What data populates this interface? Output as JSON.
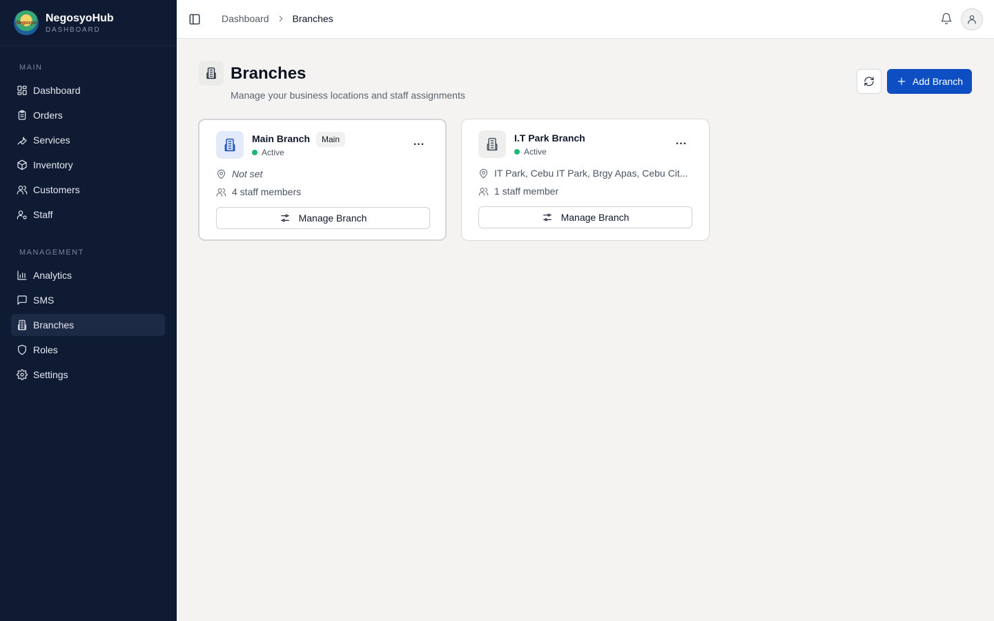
{
  "brand": {
    "name": "NegosyoHub",
    "subtitle": "DASHBOARD",
    "logo_text": "Negosyo"
  },
  "sidebar": {
    "sections": [
      {
        "label": "MAIN"
      },
      {
        "label": "MANAGEMENT"
      }
    ],
    "items": [
      {
        "label": "Dashboard",
        "icon": "dashboard-icon"
      },
      {
        "label": "Orders",
        "icon": "clipboard-icon"
      },
      {
        "label": "Services",
        "icon": "wrench-icon"
      },
      {
        "label": "Inventory",
        "icon": "package-icon"
      },
      {
        "label": "Customers",
        "icon": "users-icon"
      },
      {
        "label": "Staff",
        "icon": "user-cog-icon"
      },
      {
        "label": "Analytics",
        "icon": "bar-chart-icon"
      },
      {
        "label": "SMS",
        "icon": "message-icon"
      },
      {
        "label": "Branches",
        "icon": "building-icon",
        "active": true
      },
      {
        "label": "Roles",
        "icon": "shield-icon"
      },
      {
        "label": "Settings",
        "icon": "gear-icon"
      }
    ]
  },
  "topbar": {
    "breadcrumb": {
      "parent": "Dashboard",
      "current": "Branches"
    }
  },
  "page": {
    "title": "Branches",
    "subtitle": "Manage your business locations and staff assignments",
    "add_label": "Add Branch"
  },
  "branches": [
    {
      "name": "Main Branch",
      "badge": "Main",
      "status": "Active",
      "location": "Not set",
      "staff": "4 staff members",
      "manage_label": "Manage Branch",
      "more": "..."
    },
    {
      "name": "I.T Park Branch",
      "status": "Active",
      "location": "IT Park, Cebu IT Park, Brgy Apas, Cebu Cit...",
      "staff": "1 staff member",
      "manage_label": "Manage Branch",
      "more": "..."
    }
  ],
  "colors": {
    "sidebar_bg": "#0f1b33",
    "primary": "#0d4fc2",
    "status_active": "#22b573",
    "page_bg": "#f4f3f1"
  }
}
